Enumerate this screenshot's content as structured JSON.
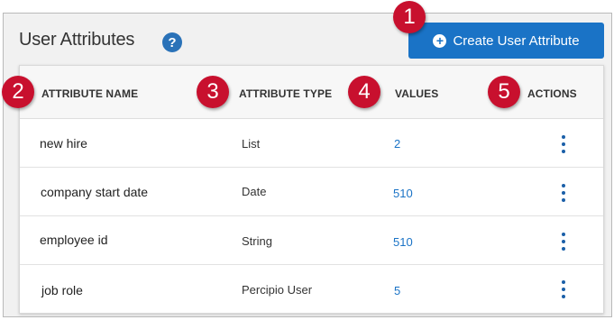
{
  "header": {
    "title": "User Attributes",
    "help_glyph": "?",
    "create_button_label": "Create User Attribute",
    "create_button_icon": "plus-circle-icon"
  },
  "table": {
    "columns": [
      "ATTRIBUTE NAME",
      "ATTRIBUTE TYPE",
      "VALUES",
      "ACTIONS"
    ],
    "rows": [
      {
        "name": "new hire",
        "type": "List",
        "values": "2"
      },
      {
        "name": "company start date",
        "type": "Date",
        "values": "510"
      },
      {
        "name": "employee id",
        "type": "String",
        "values": "510"
      },
      {
        "name": "job role",
        "type": "Percipio User",
        "values": "5"
      }
    ]
  },
  "callouts": [
    "1",
    "2",
    "3",
    "4",
    "5"
  ],
  "colors": {
    "accent": "#1a73c6",
    "callout": "#c8102e"
  }
}
